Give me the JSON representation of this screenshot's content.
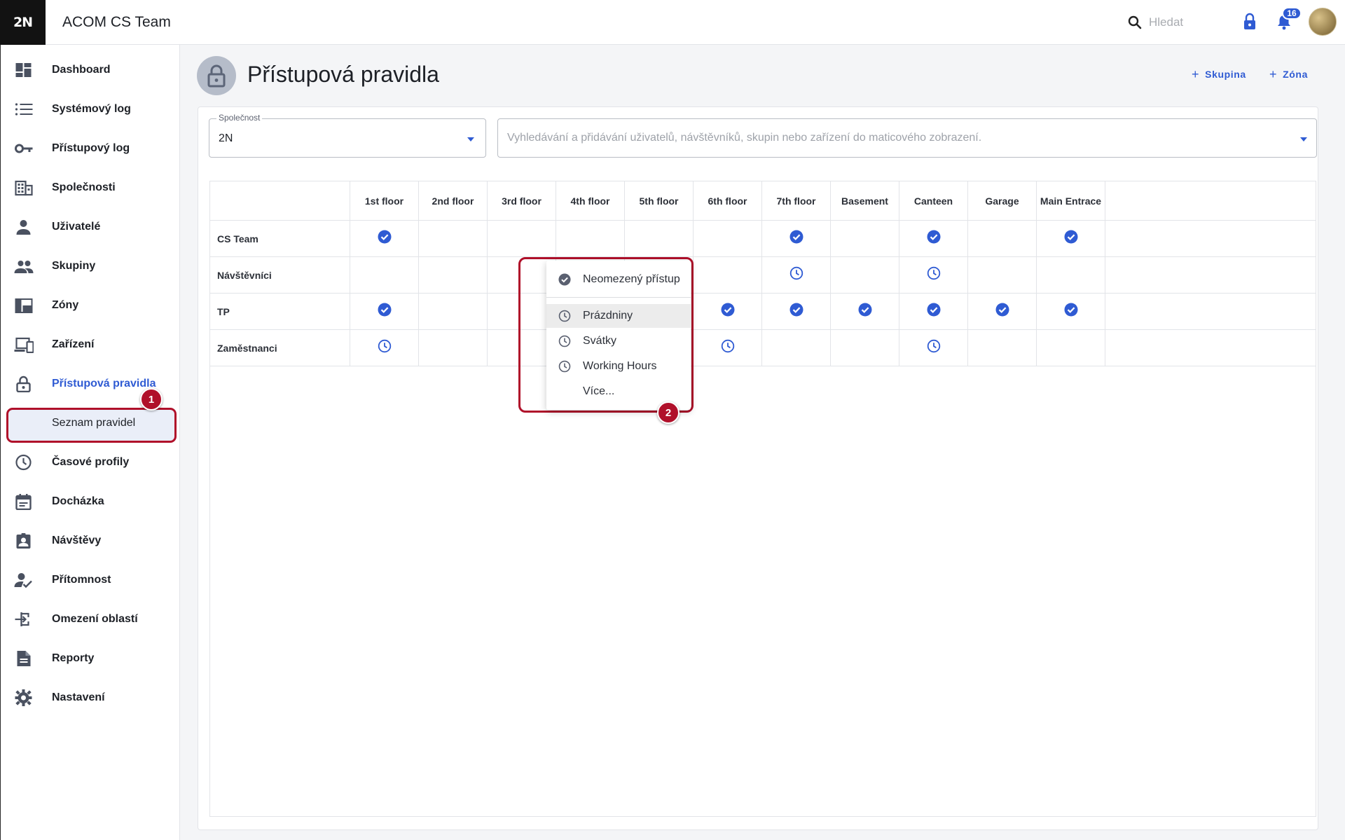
{
  "topbar": {
    "logo": "2N",
    "title": "ACOM CS Team",
    "search_placeholder": "Hledat",
    "notifications": "16"
  },
  "sidebar": {
    "items": [
      {
        "label": "Dashboard",
        "icon": "dashboard-icon"
      },
      {
        "label": "Systémový log",
        "icon": "list-icon"
      },
      {
        "label": "Přístupový log",
        "icon": "key-icon"
      },
      {
        "label": "Společnosti",
        "icon": "building-icon"
      },
      {
        "label": "Uživatelé",
        "icon": "person-icon"
      },
      {
        "label": "Skupiny",
        "icon": "people-icon"
      },
      {
        "label": "Zóny",
        "icon": "zones-icon"
      },
      {
        "label": "Zařízení",
        "icon": "devices-icon"
      },
      {
        "label": "Přístupová pravidla",
        "icon": "lock-icon"
      },
      {
        "label": "Seznam pravidel",
        "icon": ""
      },
      {
        "label": "Časové profily",
        "icon": "clock-icon"
      },
      {
        "label": "Docházka",
        "icon": "calendar-icon"
      },
      {
        "label": "Návštěvy",
        "icon": "visitor-icon"
      },
      {
        "label": "Přítomnost",
        "icon": "presence-icon"
      },
      {
        "label": "Omezení oblastí",
        "icon": "area-limit-icon"
      },
      {
        "label": "Reporty",
        "icon": "report-icon"
      },
      {
        "label": "Nastavení",
        "icon": "gear-icon"
      }
    ],
    "active_index": 8
  },
  "markers": {
    "first": "1",
    "second": "2"
  },
  "page": {
    "title": "Přístupová pravidla",
    "add_group": "Skupina",
    "add_zone": "Zóna"
  },
  "filters": {
    "company_label": "Společnost",
    "company_value": "2N",
    "matrix_placeholder": "Vyhledávání a přidávání uživatelů, návštěvníků, skupin nebo zařízení do maticového zobrazení."
  },
  "matrix": {
    "columns": [
      "1st floor",
      "2nd floor",
      "3rd floor",
      "4th floor",
      "5th floor",
      "6th floor",
      "7th floor",
      "Basement",
      "Canteen",
      "Garage",
      "Main Entrace"
    ],
    "rows": [
      {
        "label": "CS Team",
        "cells": [
          "check",
          "",
          "",
          "",
          "",
          "",
          "check",
          "",
          "check",
          "",
          "check"
        ]
      },
      {
        "label": "Návštěvníci",
        "cells": [
          "",
          "",
          "",
          "",
          "",
          "",
          "clock",
          "",
          "clock",
          "",
          ""
        ]
      },
      {
        "label": "TP",
        "cells": [
          "check",
          "",
          "",
          "",
          "",
          "check",
          "check",
          "check",
          "check",
          "check",
          "check"
        ]
      },
      {
        "label": "Zaměstnanci",
        "cells": [
          "clock",
          "",
          "",
          "",
          "",
          "clock",
          "",
          "",
          "clock",
          "",
          ""
        ]
      }
    ],
    "colors": {
      "accent": "#2f5bd3",
      "highlight": "#b0102a"
    }
  },
  "menu": {
    "items": [
      {
        "label": "Neomezený přístup",
        "icon": "check-circle-icon"
      },
      {
        "label": "Prázdniny",
        "icon": "clock-icon"
      },
      {
        "label": "Svátky",
        "icon": "clock-icon"
      },
      {
        "label": "Working Hours",
        "icon": "clock-icon"
      },
      {
        "label": "Více...",
        "icon": ""
      }
    ]
  }
}
